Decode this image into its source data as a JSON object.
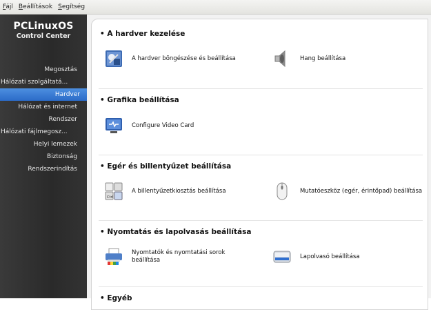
{
  "menubar": [
    {
      "accel": "F",
      "rest": "ájl"
    },
    {
      "accel": "B",
      "rest": "eállítások"
    },
    {
      "accel": "S",
      "rest": "egítség"
    }
  ],
  "brand": {
    "title": "PCLinuxOS",
    "subtitle": "Control Center"
  },
  "sidebar": {
    "items": [
      {
        "label": "Megosztás"
      },
      {
        "label": "Hálózati szolgáltatá..."
      },
      {
        "label": "Hardver"
      },
      {
        "label": "Hálózat és internet"
      },
      {
        "label": "Rendszer"
      },
      {
        "label": "Hálózati fájlmegosz..."
      },
      {
        "label": "Helyi lemezek"
      },
      {
        "label": "Biztonság"
      },
      {
        "label": "Rendszerindítás"
      }
    ]
  },
  "sections": [
    {
      "title": "• A hardver kezelése",
      "items": [
        {
          "label": "A hardver böngészése és beállítása",
          "icon": "hardware-config-icon"
        },
        {
          "label": "Hang beállítása",
          "icon": "speaker-icon"
        }
      ]
    },
    {
      "title": "• Grafika beállítása",
      "items": [
        {
          "label": "Configure Video Card",
          "icon": "video-card-icon"
        }
      ]
    },
    {
      "title": "• Egér és billentyűzet beállítása",
      "items": [
        {
          "label": "A billentyűzetkiosztás beállítása",
          "icon": "keyboard-icon"
        },
        {
          "label": "Mutatóeszköz (egér, érintőpad) beállítása",
          "icon": "mouse-icon"
        }
      ]
    },
    {
      "title": "• Nyomtatás és lapolvasás beállítása",
      "items": [
        {
          "label": "Nyomtatók és nyomtatási sorok beállítása",
          "icon": "printer-icon"
        },
        {
          "label": "Lapolvasó beállítása",
          "icon": "scanner-icon"
        }
      ]
    },
    {
      "title": "• Egyéb",
      "items": []
    }
  ],
  "colors": {
    "sidebar_active": "#2b6bc8",
    "sidebar_bg": "#2f2f2f"
  }
}
